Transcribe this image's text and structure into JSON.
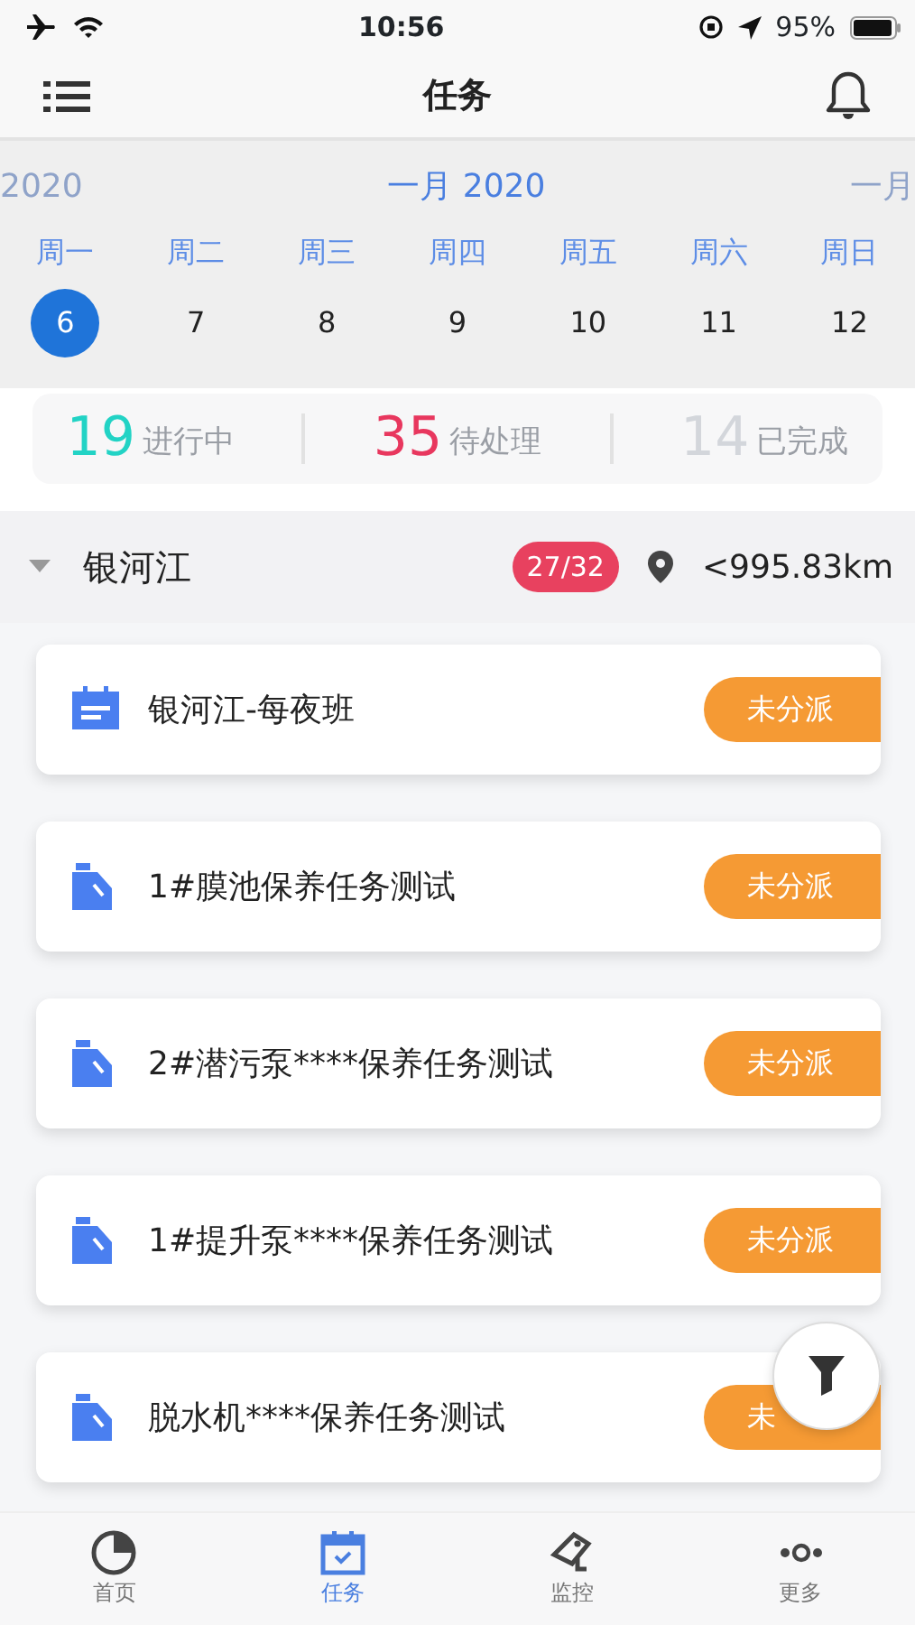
{
  "status_bar": {
    "time": "10:56",
    "battery": "95%"
  },
  "nav": {
    "title": "任务"
  },
  "calendar": {
    "months": [
      {
        "label": "2020",
        "current": false
      },
      {
        "label": "一月 2020",
        "current": true
      },
      {
        "label": "一月",
        "current": false
      }
    ],
    "days": [
      {
        "weekday": "周一",
        "date": "6",
        "selected": true
      },
      {
        "weekday": "周二",
        "date": "7",
        "selected": false
      },
      {
        "weekday": "周三",
        "date": "8",
        "selected": false
      },
      {
        "weekday": "周四",
        "date": "9",
        "selected": false
      },
      {
        "weekday": "周五",
        "date": "10",
        "selected": false
      },
      {
        "weekday": "周六",
        "date": "11",
        "selected": false
      },
      {
        "weekday": "周日",
        "date": "12",
        "selected": false
      }
    ]
  },
  "stats": [
    {
      "value": "19",
      "label": "进行中",
      "color": "#22d3c5"
    },
    {
      "value": "35",
      "label": "待处理",
      "color": "#e8375e"
    },
    {
      "value": "14",
      "label": "已完成",
      "color": "#d3d6db"
    }
  ],
  "group": {
    "name": "银河江",
    "expanded": true,
    "count": "27/32",
    "distance": "<995.83km"
  },
  "tasks": [
    {
      "kind": "schedule",
      "title": "银河江-每夜班",
      "status": "未分派"
    },
    {
      "kind": "maintenance",
      "title": "1#膜池保养任务测试",
      "status": "未分派"
    },
    {
      "kind": "maintenance",
      "title": "2#潜污泵****保养任务测试",
      "status": "未分派"
    },
    {
      "kind": "maintenance",
      "title": "1#提升泵****保养任务测试",
      "status": "未分派"
    },
    {
      "kind": "maintenance",
      "title": "脱水机****保养任务测试",
      "status": "未"
    }
  ],
  "tab_bar": [
    {
      "kind": "home",
      "label": "首页",
      "selected": false
    },
    {
      "kind": "tasks",
      "label": "任务",
      "selected": true
    },
    {
      "kind": "monitor",
      "label": "监控",
      "selected": false
    },
    {
      "kind": "more",
      "label": "更多",
      "selected": false
    }
  ]
}
